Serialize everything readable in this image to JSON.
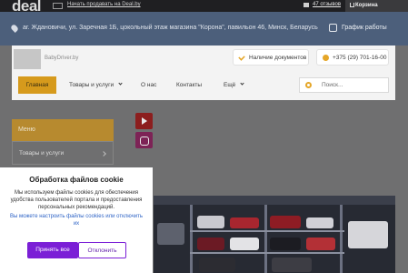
{
  "topbar": {
    "brand": "deal",
    "create_link": "Начать продавать на Deal.by",
    "reviews": "47 отзывов",
    "cart": "Корзина"
  },
  "address_bar": {
    "address": "аг. Ждановичи, ул. Заречная 1Б, цокольный этаж магазина \"Корона\", павильон 46, Минск, Беларусь",
    "hours": "График работы"
  },
  "header": {
    "logo_text": "BabyDriver.by",
    "docs_button": "Наличие документов",
    "phone": "+375 (29) 701-16-00"
  },
  "nav": {
    "items": [
      "Главная",
      "Товары и услуги",
      "О нас",
      "Контакты",
      "Ещё"
    ],
    "search_placeholder": "Поиск..."
  },
  "sidebar": {
    "menu_title": "Меню",
    "menu_item": "Товары и услуги"
  },
  "cookie": {
    "title": "Обработка файлов cookie",
    "text": "Мы используем файлы cookies для обеспечения удобства пользователей портала и предоставления персональных рекомендаций.",
    "link": "Вы можете настроить файлы cookies или отключить их",
    "accept": "Принять все",
    "reject": "Отклонить"
  },
  "colors": {
    "accent": "#d69a1c",
    "cookie_button": "#7b1fd6"
  }
}
